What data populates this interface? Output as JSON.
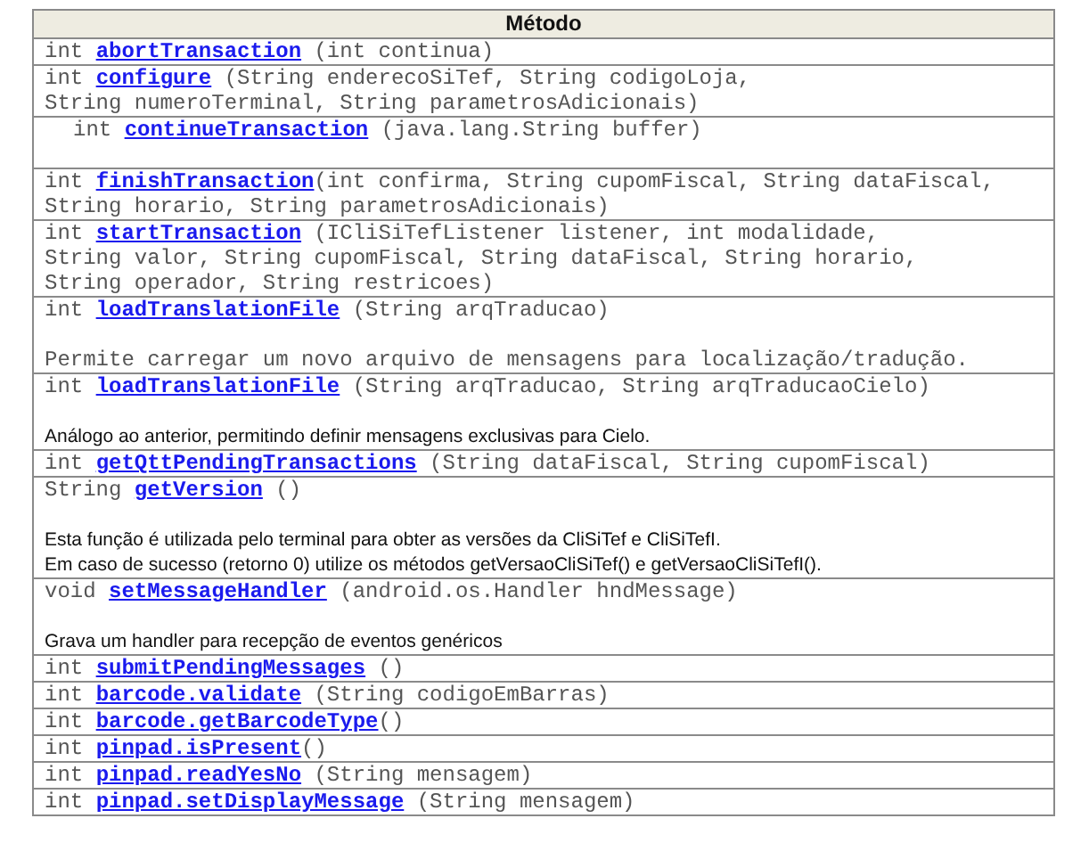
{
  "table": {
    "header": "Método",
    "rows": [
      {
        "kind": "plain",
        "type": "int",
        "name": "abortTransaction",
        "params": [
          " (int continua)"
        ]
      },
      {
        "kind": "plain",
        "type": "int",
        "name": "configure",
        "params": [
          " (String enderecoSiTef, String codigoLoja,",
          "String numeroTerminal, String parametrosAdicionais)"
        ]
      },
      {
        "kind": "indented",
        "type": "int",
        "name": "continueTransaction",
        "params": [
          " (java.lang.String buffer)"
        ]
      },
      {
        "kind": "plain",
        "type": "int",
        "name": "finishTransaction",
        "params": [
          "(int confirma, String cupomFiscal, String dataFiscal,",
          "String horario, String parametrosAdicionais)"
        ]
      },
      {
        "kind": "plain",
        "type": "int",
        "name": "startTransaction",
        "params": [
          " (ICliSiTefListener listener, int modalidade,",
          "String valor, String cupomFiscal, String dataFiscal, String horario,",
          "String operador, String restricoes)"
        ]
      },
      {
        "kind": "plain",
        "type": "int",
        "name": "loadTranslationFile",
        "params": [
          " (String arqTraducao)"
        ],
        "description": {
          "kind": "mono",
          "lines": [
            "Permite carregar um novo arquivo de mensagens para localização/tradução."
          ]
        }
      },
      {
        "kind": "plain",
        "type": "int",
        "name": "loadTranslationFile",
        "params": [
          " (String arqTraducao, String arqTraducaoCielo)"
        ],
        "description": {
          "kind": "sans",
          "lines": [
            "Análogo ao anterior, permitindo definir mensagens exclusivas para Cielo."
          ]
        }
      },
      {
        "kind": "plain",
        "type": "int",
        "name": "getQttPendingTransactions",
        "params": [
          " (String dataFiscal, String cupomFiscal)"
        ]
      },
      {
        "kind": "plain",
        "type": "String",
        "name": "getVersion",
        "params": [
          " ()"
        ],
        "description": {
          "kind": "sans",
          "lines": [
            "Esta função é utilizada pelo terminal para obter as versões da CliSiTef e CliSiTefI.",
            "Em caso de sucesso (retorno 0) utilize os métodos getVersaoCliSiTef() e getVersaoCliSiTefI()."
          ]
        }
      },
      {
        "kind": "plain",
        "type": "void",
        "name": "setMessageHandler",
        "params": [
          " (android.os.Handler hndMessage)"
        ],
        "description": {
          "kind": "sans",
          "lines": [
            "Grava um handler para recepção de eventos genéricos"
          ]
        }
      },
      {
        "kind": "plain",
        "type": "int",
        "name": "submitPendingMessages",
        "params": [
          " ()"
        ]
      },
      {
        "kind": "plain",
        "type": "int",
        "name": "barcode.validate",
        "params": [
          " (String codigoEmBarras)"
        ]
      },
      {
        "kind": "plain",
        "type": "int",
        "name": "barcode.getBarcodeType",
        "params": [
          "()"
        ]
      },
      {
        "kind": "plain",
        "type": "int",
        "name": "pinpad.isPresent",
        "params": [
          "()"
        ]
      },
      {
        "kind": "plain",
        "type": "int",
        "name": "pinpad.readYesNo",
        "params": [
          " (String mensagem)"
        ]
      },
      {
        "kind": "plain",
        "type": "int",
        "name": "pinpad.setDisplayMessage",
        "params": [
          " (String mensagem)"
        ]
      }
    ]
  }
}
